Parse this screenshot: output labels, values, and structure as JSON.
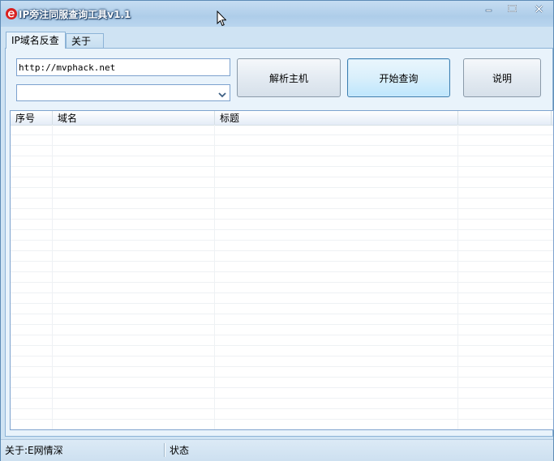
{
  "window": {
    "title": "IP旁注同服查询工具v1.1"
  },
  "tabs": [
    {
      "label": "IP域名反查",
      "active": true
    },
    {
      "label": "关于",
      "active": false
    }
  ],
  "form": {
    "url_value": "http://mvphack.net",
    "combo_value": ""
  },
  "buttons": {
    "resolve_label": "解析主机",
    "start_label": "开始查询",
    "help_label": "说明"
  },
  "list": {
    "columns": [
      "序号",
      "域名",
      "标题",
      ""
    ]
  },
  "statusbar": {
    "left_text": "关于:E网情深",
    "right_text": "状态"
  },
  "colors": {
    "window_frame": "#cfe3f3",
    "title_text": "#ffffff",
    "accent_button": "#3c7fb1",
    "app_icon": "#d9201f"
  },
  "icons": {
    "app": "ie-e-logo-icon",
    "minimize": "minimize-icon",
    "maximize": "maximize-icon",
    "close": "close-icon",
    "combo": "chevron-down-icon",
    "pointer": "mouse-cursor-icon"
  }
}
